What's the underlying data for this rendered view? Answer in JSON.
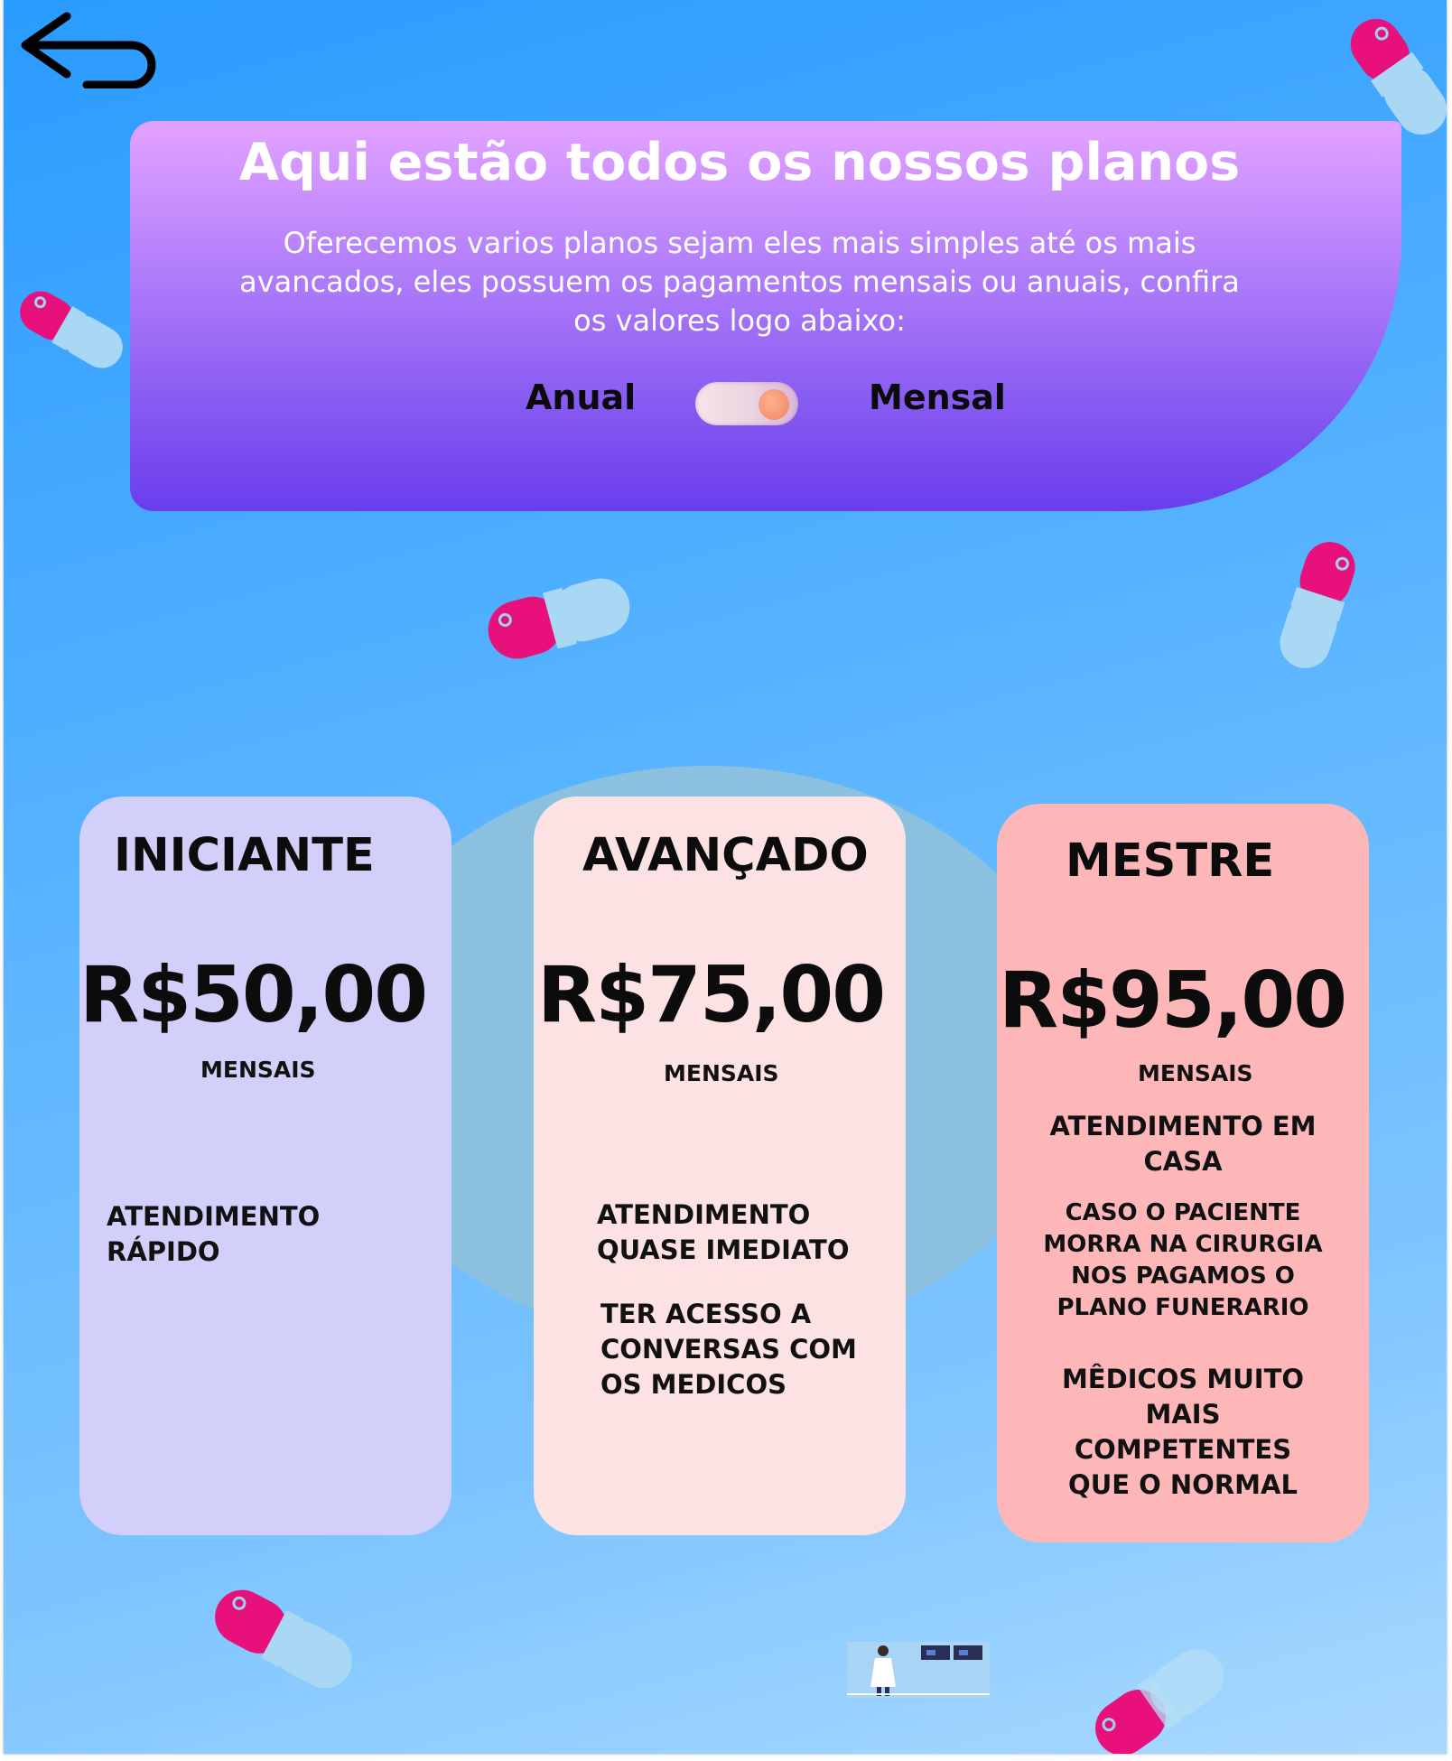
{
  "header": {
    "back_label": "Voltar",
    "title": "Aqui estão todos os nossos planos",
    "description": "Oferecemos  varios planos sejam eles mais simples até os mais avancados, eles possuem os  pagamentos mensais ou anuais, confira os valores logo abaixo:"
  },
  "billing_toggle": {
    "left_label": "Anual",
    "right_label": "Mensal",
    "selected": "Mensal"
  },
  "plans": [
    {
      "name": "INICIANTE",
      "price": "R$50,00",
      "period": "MENSAIS",
      "features": [
        "ATENDIMENTO\nRÁPIDO"
      ],
      "color": "#d3cffb"
    },
    {
      "name": "AVANÇADO",
      "price": "R$75,00",
      "period": "MENSAIS",
      "features": [
        "ATENDIMENTO\nQUASE IMEDIATO",
        "TER ACESSO A\nCONVERSAS COM\nOS MEDICOS"
      ],
      "color": "#fde2e4"
    },
    {
      "name": "MESTRE",
      "price": "R$95,00",
      "period": "MENSAIS",
      "features": [
        "ATENDIMENTO EM\nCASA",
        "CASO O PACIENTE\nMORRA NA CIRURGIA\nNOS PAGAMOS O\nPLANO FUNERARIO",
        "MÊDICOS MUITO\nMAIS\nCOMPETENTES\nQUE O NORMAL"
      ],
      "color": "#fdb7b9"
    }
  ],
  "colors": {
    "background_top": "#2a9bff",
    "background_bottom": "#a9d9ff",
    "hero_top": "#e3a2ff",
    "hero_bottom": "#6a3ded",
    "pill_pink": "#e8117c",
    "pill_blue": "#a9d8f4"
  },
  "icons": {
    "back": "back-arrow-icon",
    "decoration": "pill-capsule-icon",
    "illustration": "doctor-illustration-icon"
  }
}
